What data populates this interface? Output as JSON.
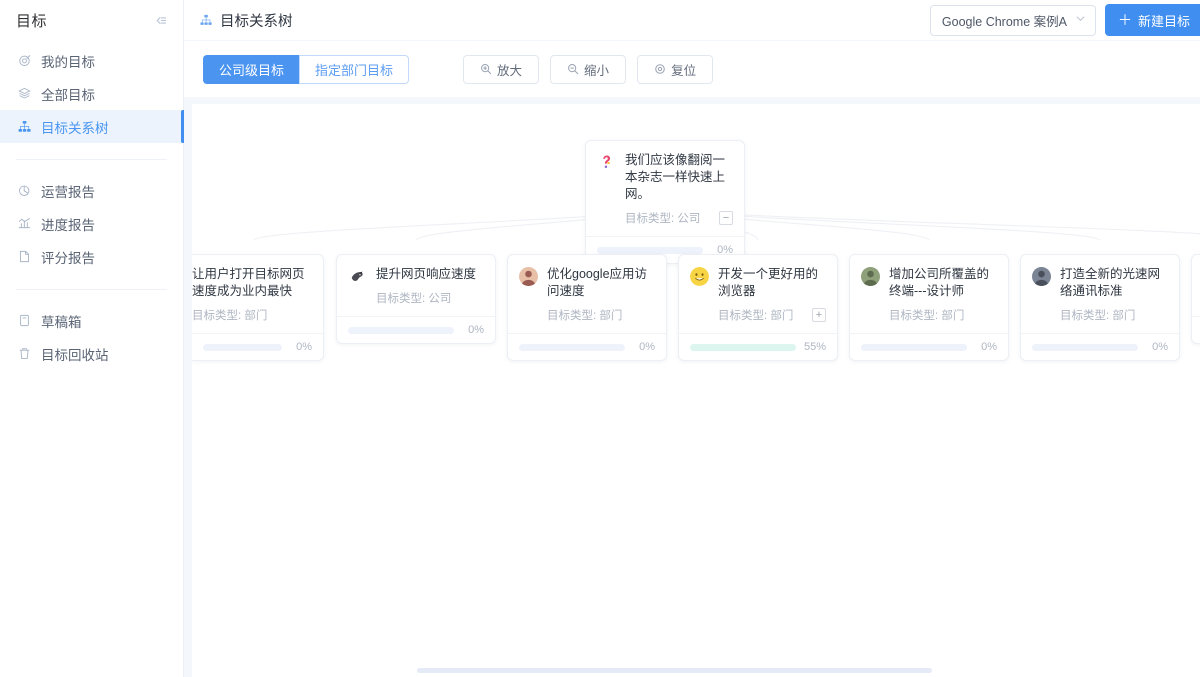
{
  "sidebar": {
    "title": "目标",
    "collapse_icon": "panel-collapse-icon",
    "groups": [
      {
        "items": [
          {
            "label": "我的目标",
            "icon": "target-icon",
            "active": false
          },
          {
            "label": "全部目标",
            "icon": "layers-icon",
            "active": false
          },
          {
            "label": "目标关系树",
            "icon": "org-tree-icon",
            "active": true
          }
        ]
      },
      {
        "items": [
          {
            "label": "运营报告",
            "icon": "pie-chart-icon",
            "active": false
          },
          {
            "label": "进度报告",
            "icon": "bar-chart-icon",
            "active": false
          },
          {
            "label": "评分报告",
            "icon": "document-icon",
            "active": false
          }
        ]
      },
      {
        "items": [
          {
            "label": "草稿箱",
            "icon": "inbox-icon",
            "active": false
          },
          {
            "label": "目标回收站",
            "icon": "trash-icon",
            "active": false
          }
        ]
      }
    ]
  },
  "topbar": {
    "icon": "org-tree-icon",
    "title": "目标关系树",
    "cycle_select": {
      "value": "Google Chrome 案例A",
      "icon": "chevron-down-icon"
    },
    "new_goal_button": {
      "label": "新建目标",
      "icon": "plus-icon"
    }
  },
  "toolbar": {
    "segments": [
      {
        "label": "公司级目标",
        "selected": true
      },
      {
        "label": "指定部门目标",
        "selected": false
      }
    ],
    "actions": [
      {
        "label": "放大",
        "icon": "zoom-in-icon"
      },
      {
        "label": "缩小",
        "icon": "zoom-out-icon"
      },
      {
        "label": "复位",
        "icon": "reset-icon"
      }
    ]
  },
  "colors": {
    "accent": "#3f8ef0",
    "progress_green": "#3ecfb0",
    "progress_track": "#eef2fb",
    "progress_track_green": "#ddf5ef",
    "sidebar_active_bg": "#ecf3fd",
    "canvas_bg": "#ffffff",
    "page_bg": "#f4f7fc"
  },
  "tree": {
    "meta_label": "目标类型",
    "root": {
      "title": "我们应该像翻阅一本杂志一样快速上网。",
      "meta": "目标类型: 公司",
      "progress": 0,
      "progress_label": "0%",
      "progress_color": "#e8eefb",
      "toggle": "−",
      "toggle_name": "collapse-children-button",
      "avatar": "avatar-question-mark",
      "avatar_colors": [
        "#e8486f",
        "#f5c33b",
        "#8a6bd1"
      ]
    },
    "children": [
      {
        "title": "让用户打开目标网页速度成为业内最快",
        "meta": "目标类型: 部门",
        "progress": 0,
        "progress_label": "0%",
        "progress_color": "#e8eefb",
        "toggle": null,
        "avatar": "avatar-photo-1",
        "avatar_colors": [
          "#c9d3e2",
          "#9fb0c7"
        ],
        "clipped_left": true
      },
      {
        "title": "提升网页响应速度",
        "meta": "目标类型: 公司",
        "progress": 0,
        "progress_label": "0%",
        "progress_color": "#e8eefb",
        "toggle": null,
        "avatar": "avatar-bird",
        "avatar_colors": [
          "#4a4a52",
          "#2e2e36"
        ]
      },
      {
        "title": "优化google应用访问速度",
        "meta": "目标类型: 部门",
        "progress": 0,
        "progress_label": "0%",
        "progress_color": "#e8eefb",
        "toggle": null,
        "avatar": "avatar-photo-2",
        "avatar_colors": [
          "#9a5c52",
          "#e8c0a8"
        ]
      },
      {
        "title": "开发一个更好用的浏览器",
        "meta": "目标类型: 部门",
        "progress": 55,
        "progress_label": "55%",
        "progress_color": "#3ecfb0",
        "toggle": "+",
        "toggle_name": "expand-children-button",
        "avatar": "avatar-smiley",
        "avatar_colors": [
          "#f7d444",
          "#e8b92c"
        ]
      },
      {
        "title": "增加公司所覆盖的终端---设计师",
        "meta": "目标类型: 部门",
        "progress": 0,
        "progress_label": "0%",
        "progress_color": "#e8eefb",
        "toggle": null,
        "avatar": "avatar-photo-3",
        "avatar_colors": [
          "#5d6b4e",
          "#8ea07a"
        ]
      },
      {
        "title": "打造全新的光速网络通讯标准",
        "meta": "目标类型: 部门",
        "progress": 0,
        "progress_label": "0%",
        "progress_color": "#e8eefb",
        "toggle": null,
        "avatar": "avatar-photo-4",
        "avatar_colors": [
          "#4a4f5c",
          "#7b8494"
        ]
      },
      {
        "title": "",
        "meta": "",
        "progress": 0,
        "progress_label": "",
        "progress_color": "#d9f2f5",
        "toggle": null,
        "avatar": "avatar-photo-5",
        "avatar_colors": [
          "#b07c9a",
          "#e0a8c4"
        ],
        "clipped_right": true
      }
    ]
  },
  "scrollbar": {
    "name": "horizontal-scrollbar"
  }
}
